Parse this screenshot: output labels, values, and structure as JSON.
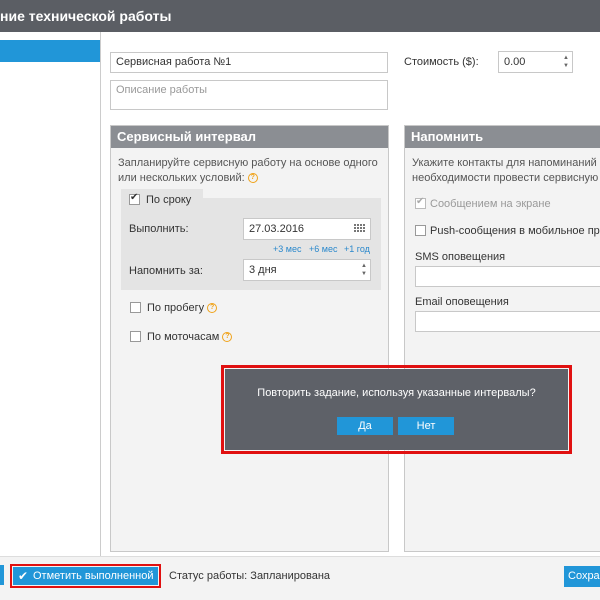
{
  "window": {
    "title": "ние технической работы"
  },
  "form": {
    "name_value": "Сервисная работа №1",
    "description_placeholder": "Описание работы",
    "cost_label": "Стоимость ($):",
    "cost_value": "0.00"
  },
  "service_interval": {
    "title": "Сервисный интервал",
    "description": "Запланируйте сервисную работу на основе одного или нескольких условий:",
    "by_term": {
      "label": "По сроку",
      "checked": true,
      "execute_label": "Выполнить:",
      "date_value": "27.03.2016",
      "quick_links": [
        "+3 мес",
        "+6 мес",
        "+1 год"
      ],
      "remind_label": "Напомнить за:",
      "remind_value": "3 дня"
    },
    "by_mileage": {
      "label": "По пробегу",
      "checked": false
    },
    "by_engine_hours": {
      "label": "По моточасам",
      "checked": false
    }
  },
  "remind": {
    "title": "Напомнить",
    "description": "Укажите контакты для напоминаний о необходимости провести сервисную работу:",
    "on_screen_label": "Сообщением на экране",
    "push_label": "Push-сообщения в мобильное прил",
    "sms_label": "SMS оповещения",
    "email_label": "Email оповещения"
  },
  "footer": {
    "mark_done_label": "Отметить выполненной",
    "status_text": "Статус работы: Запланирована",
    "save_label": "Сохра"
  },
  "dialog": {
    "message": "Повторить задание, используя указанные интервалы?",
    "yes_label": "Да",
    "no_label": "Нет"
  },
  "colors": {
    "accent": "#2196d8",
    "header": "#5b5e64",
    "panel_header": "#8b8e93",
    "dialog_bg": "#5e6168",
    "highlight": "#e01010"
  }
}
